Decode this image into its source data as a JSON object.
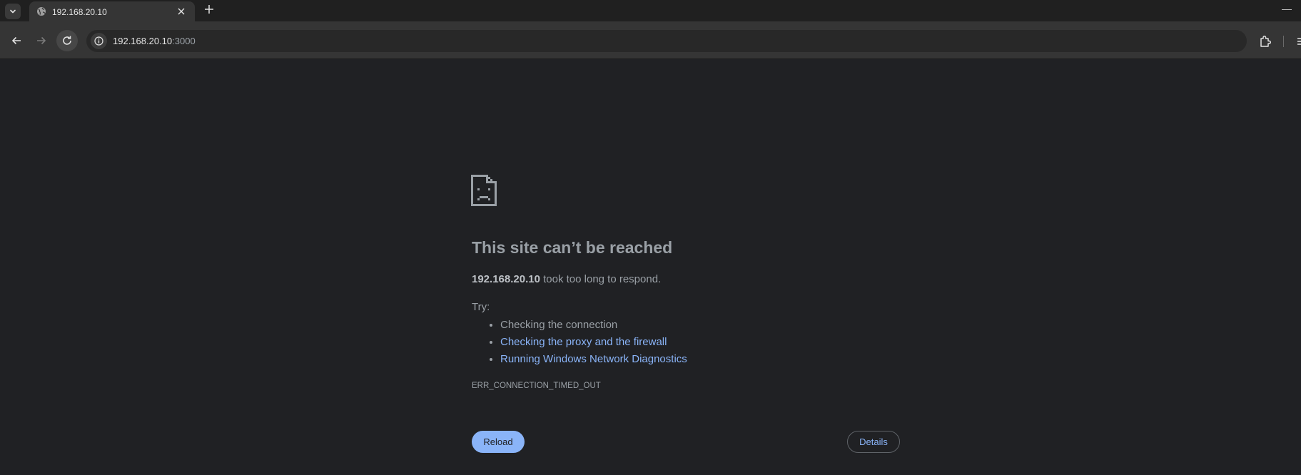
{
  "browser": {
    "tab": {
      "title": "192.168.20.10",
      "favicon": "globe-icon",
      "close_icon": "close-icon"
    },
    "new_tab_icon": "plus-icon",
    "minimize_label": "—",
    "address": {
      "host": "192.168.20.10",
      "port": ":3000"
    }
  },
  "error_page": {
    "icon": "sad-page-icon",
    "heading": "This site can’t be reached",
    "host": "192.168.20.10",
    "message": " took too long to respond.",
    "try_label": "Try:",
    "suggestions": [
      {
        "text": "Checking the connection",
        "link": false
      },
      {
        "text": "Checking the proxy and the firewall",
        "link": true
      },
      {
        "text": "Running Windows Network Diagnostics",
        "link": true
      }
    ],
    "error_code": "ERR_CONNECTION_TIMED_OUT",
    "reload_label": "Reload",
    "details_label": "Details"
  },
  "colors": {
    "background": "#202124",
    "text": "#9aa0a6",
    "link": "#8ab4f8",
    "reload_button": "#8ab4f8"
  }
}
